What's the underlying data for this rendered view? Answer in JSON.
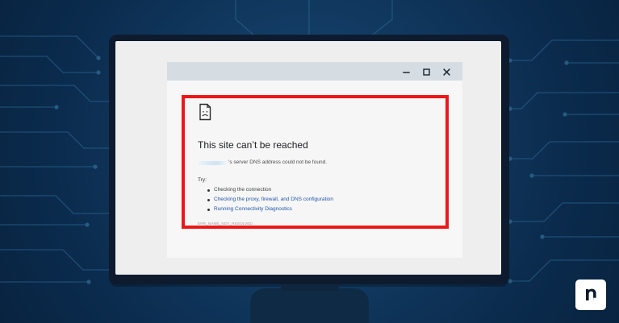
{
  "browser": {
    "window_controls": [
      {
        "icon": "minimize-icon"
      },
      {
        "icon": "maximize-icon"
      },
      {
        "icon": "close-icon"
      }
    ]
  },
  "error_page": {
    "icon": "sad-page-icon",
    "title": "This site can’t be reached",
    "dns_message": "’s server DNS address could not be found.",
    "try_label": "Try:",
    "suggestions": [
      {
        "label": "Checking the connection",
        "link": false
      },
      {
        "label": "Checking the proxy, firewall, and DNS configuration",
        "link": true
      },
      {
        "label": "Running Connectivity Diagnostics",
        "link": true
      }
    ],
    "error_code": "ERR_NAME_NOT_RESOLVED"
  },
  "brand": {
    "logo_icon": "n-logo-icon"
  },
  "colors": {
    "background": "#0b2b4d",
    "monitor": "#0e1b2e",
    "screen": "#eeeeee",
    "browser_titlebar": "#d6dde2",
    "error_border": "#ee1717",
    "link": "#1f57a8"
  }
}
